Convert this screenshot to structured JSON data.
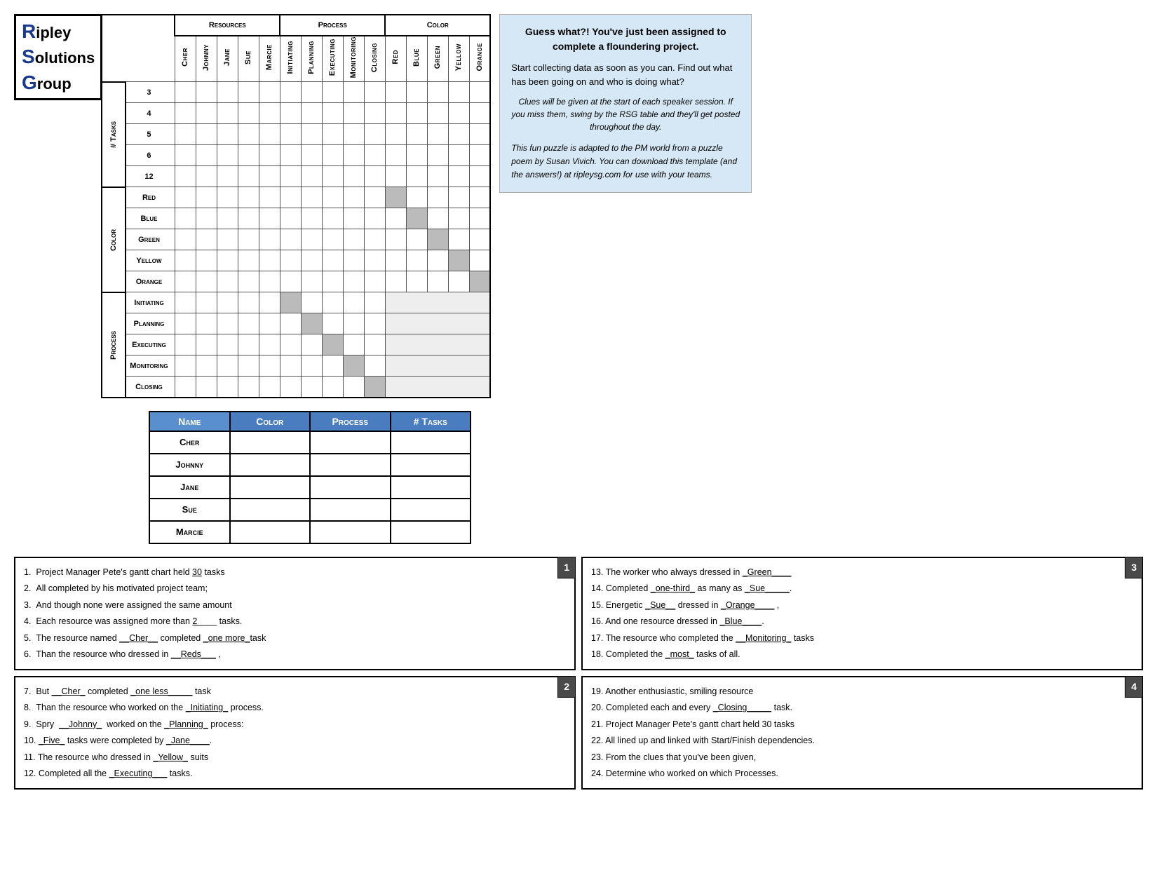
{
  "logo": {
    "line1": "ipley",
    "line2": "olutions",
    "line3": "roup"
  },
  "header": {
    "resources_label": "Resources",
    "process_label": "Process",
    "color_label": "Color"
  },
  "col_headers": {
    "resources": [
      "Cher",
      "Johnny",
      "Jane",
      "Sue",
      "Marcie"
    ],
    "process": [
      "Initiating",
      "Planning",
      "Executing",
      "Monitoring",
      "Closing"
    ],
    "color": [
      "Red",
      "Blue",
      "Green",
      "Yellow",
      "Orange"
    ]
  },
  "row_sections": {
    "tasks": {
      "label": "# Tasks",
      "rows": [
        "3",
        "4",
        "5",
        "6",
        "12"
      ]
    },
    "color": {
      "label": "Color",
      "rows": [
        "Red",
        "Blue",
        "Green",
        "Yellow",
        "Orange"
      ]
    },
    "process": {
      "label": "Process",
      "rows": [
        "Initiating",
        "Planning",
        "Executing",
        "Monitoring",
        "Closing"
      ]
    }
  },
  "info_box": {
    "title": "Guess what?! You've just been assigned to complete a floundering project.",
    "body": "Start collecting data as soon as you can.  Find out what has been going on and who is doing what?",
    "clue_note": "Clues will be given at the start of each speaker session.  If you miss them, swing by the RSG table and they'll get posted throughout the day.",
    "footer_note": "This fun puzzle is adapted to the PM world from a puzzle poem by Susan Vivich.  You can download this template (and the answers!) at ripleysg.com for use with your teams."
  },
  "answer_table": {
    "headers": [
      "Name",
      "Color",
      "Process",
      "# Tasks"
    ],
    "rows": [
      [
        "Cher",
        "",
        "",
        ""
      ],
      [
        "Johnny",
        "",
        "",
        ""
      ],
      [
        "Jane",
        "",
        "",
        ""
      ],
      [
        "Sue",
        "",
        "",
        ""
      ],
      [
        "Marcie",
        "",
        "",
        ""
      ]
    ]
  },
  "clue_box1": {
    "number": "1",
    "clues": [
      "1.  Project Manager Pete's gantt chart held __30__ tasks",
      "2.  All completed by his motivated project team;",
      "3.  And though none were assigned the same amount",
      "4.  Each resource was assigned more than __2____ tasks.",
      "5.  The resource named __Cher__ completed _one more_task",
      "6.  Than the resource who dressed in __Reds___ ,"
    ]
  },
  "clue_box2": {
    "number": "2",
    "clues": [
      "7.  But __Cher_ completed _one less_____ task",
      "8.  Than the resource who worked on the _Initiating_ process.",
      "9.  Spry  __Johnny_  worked on the _Planning_ process:",
      "10.  _Five_ tasks were completed by _Jane____.",
      "11. The resource who dressed in _Yellow_ suits",
      "12. Completed all the _Executing___ tasks."
    ]
  },
  "clue_box3": {
    "number": "3",
    "clues": [
      "13. The worker who always dressed in _Green____",
      "14. Completed _one-third_ as many as _Sue_____.",
      "15. Energetic _Sue__ dressed in _Orange____ ,",
      "16. And one resource dressed in _Blue____.",
      "17. The resource who completed the __Monitoring_ tasks",
      "18. Completed the _most_ tasks of all."
    ]
  },
  "clue_box4": {
    "number": "4",
    "clues": [
      "19. Another enthusiastic, smiling resource",
      "20. Completed each and every _Closing____ task.",
      "21. Project Manager Pete's gantt chart held 30 tasks",
      "22. All lined up and linked with Start/Finish dependencies.",
      "23. From the clues that you've been given,",
      "24. Determine who worked on which Processes."
    ]
  }
}
